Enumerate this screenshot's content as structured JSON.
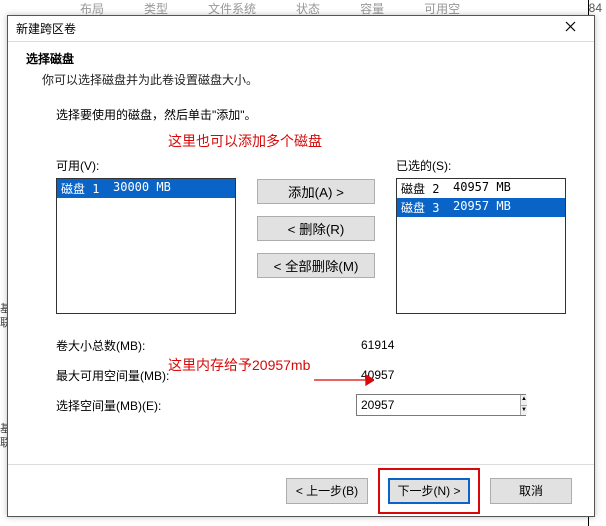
{
  "background": {
    "headers": [
      "布局",
      "类型",
      "文件系统",
      "状态",
      "容量",
      "可用空"
    ],
    "right_value": "84",
    "basic": "基",
    "online": "联"
  },
  "dialog": {
    "title": "新建跨区卷",
    "intro": {
      "heading": "选择磁盘",
      "sub": "你可以选择磁盘并为此卷设置磁盘大小。"
    },
    "instruction": "选择要使用的磁盘，然后单击\"添加\"。"
  },
  "annotations": {
    "top": "这里也可以添加多个磁盘",
    "select": "这里内存给予20957mb"
  },
  "lists": {
    "available": {
      "label": "可用(V):",
      "items": [
        {
          "name": "磁盘 1",
          "size": "30000 MB"
        }
      ]
    },
    "selected": {
      "label": "已选的(S):",
      "items": [
        {
          "name": "磁盘 2",
          "size": "40957 MB"
        },
        {
          "name": "磁盘 3",
          "size": "20957 MB"
        }
      ]
    }
  },
  "buttons": {
    "add": "添加(A) >",
    "remove": "< 删除(R)",
    "remove_all": "< 全部删除(M)",
    "back": "< 上一步(B)",
    "next": "下一步(N) >",
    "cancel": "取消"
  },
  "specs": {
    "total": {
      "label": "卷大小总数(MB):",
      "value": "61914"
    },
    "max": {
      "label": "最大可用空间量(MB):",
      "value": "40957"
    },
    "select": {
      "label": "选择空间量(MB)(E):",
      "value": "20957"
    }
  }
}
